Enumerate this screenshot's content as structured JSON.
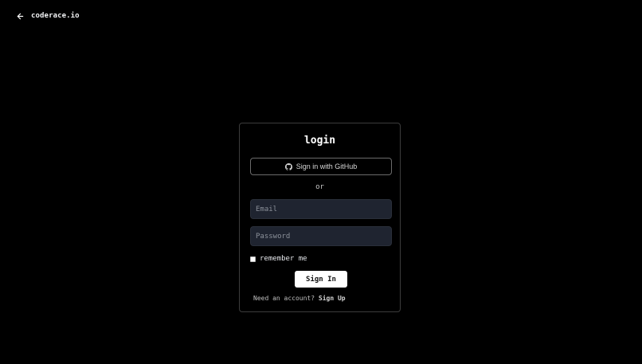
{
  "header": {
    "brand": "coderace.io",
    "back_icon": "arrow-left-icon"
  },
  "login": {
    "title": "login",
    "github_button": "Sign in with GitHub",
    "github_icon": "github-icon",
    "separator": "or",
    "email_placeholder": "Email",
    "email_value": "",
    "password_placeholder": "Password",
    "password_value": "",
    "remember_label": "remember me",
    "remember_checked": false,
    "submit_label": "Sign In",
    "footer_text": "Need an account?",
    "signup_label": "Sign Up"
  },
  "colors": {
    "background": "#000000",
    "input_background": "#1f2430",
    "border": "#3c3c3c",
    "button_background": "#ffffff"
  }
}
